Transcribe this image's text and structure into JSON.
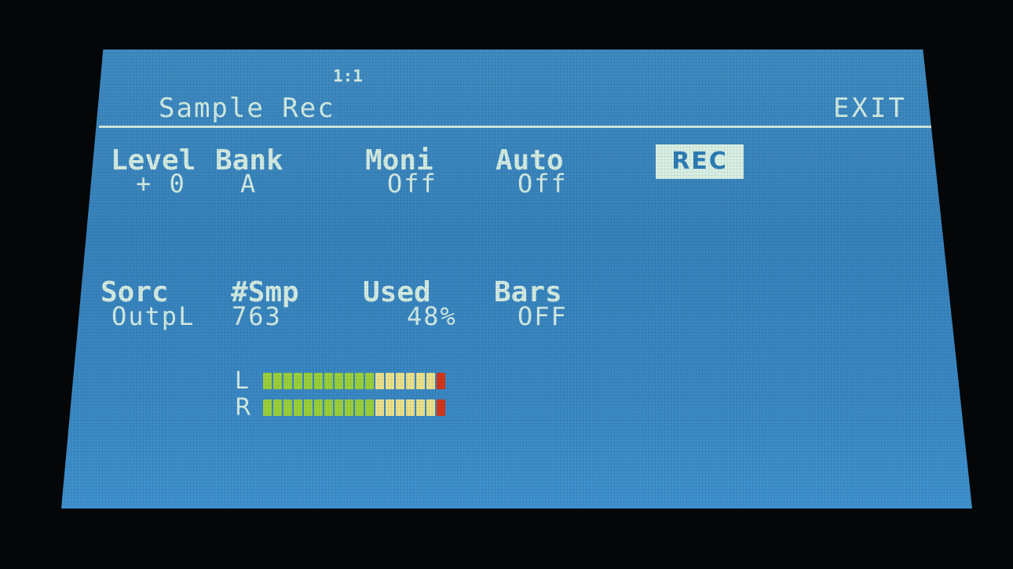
{
  "header": {
    "pattern": "1:1",
    "title": "Sample Rec",
    "exit_label": "EXIT"
  },
  "top_params": [
    {
      "label": "Level",
      "value": "+ 0"
    },
    {
      "label": "Bank",
      "value": "A"
    },
    {
      "label": "Moni",
      "value": "Off"
    },
    {
      "label": "Auto",
      "value": "Off"
    }
  ],
  "rec_label": "REC",
  "bottom_params": [
    {
      "label": "Sorc",
      "value": "OutpL"
    },
    {
      "label": "#Smp",
      "value": "763"
    },
    {
      "label": "Used",
      "value": "48%"
    },
    {
      "label": "Bars",
      "value": "OFF"
    }
  ],
  "meters": {
    "left_label": "L",
    "right_label": "R",
    "segment_colors": {
      "green": "#9bd03b",
      "yellow": "#ece28c",
      "red": "#d4361b"
    },
    "segments_per_meter": 18,
    "green_segments": 11,
    "yellow_segments": 6,
    "red_segments": 1,
    "left_level": 1.0,
    "right_level": 1.0
  },
  "colors": {
    "screen_background": "#3783bd",
    "text": "#d3ece3",
    "bezel": "#050607"
  }
}
